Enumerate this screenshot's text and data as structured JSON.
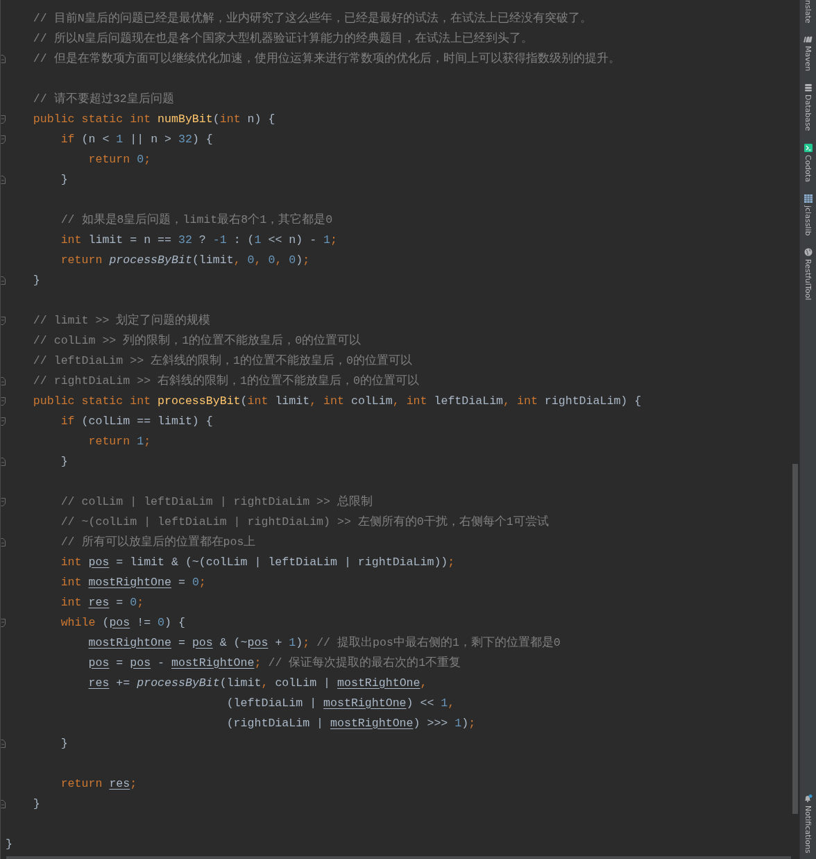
{
  "editor": {
    "lines": [
      {
        "kind": "code",
        "fold_start": false,
        "fold_end": false,
        "tokens": [
          {
            "kind": "comment",
            "text": "    // 目前N皇后的问题已经是最优解，业内研究了这么些年，已经是最好的试法，在试法上已经没有突破了。"
          }
        ]
      },
      {
        "kind": "code",
        "fold_start": false,
        "fold_end": false,
        "tokens": [
          {
            "kind": "comment",
            "text": "    // 所以N皇后问题现在也是各个国家大型机器验证计算能力的经典题目，在试法上已经到头了。"
          }
        ]
      },
      {
        "kind": "code",
        "fold_start": false,
        "fold_end": true,
        "tokens": [
          {
            "kind": "comment",
            "text": "    // 但是在常数项方面可以继续优化加速，使用位运算来进行常数项的优化后，时间上可以获得指数级别的提升。"
          }
        ]
      },
      {
        "kind": "blank"
      },
      {
        "kind": "code",
        "fold_start": false,
        "fold_end": false,
        "tokens": [
          {
            "kind": "comment",
            "text": "    // 请不要超过32皇后问题"
          }
        ]
      },
      {
        "kind": "code",
        "fold_start": true,
        "fold_end": false,
        "tokens": [
          {
            "kind": "keyword",
            "text": "    public static int "
          },
          {
            "kind": "method",
            "text": "numByBit"
          },
          {
            "kind": "text",
            "text": "("
          },
          {
            "kind": "keyword",
            "text": "int "
          },
          {
            "kind": "text",
            "text": "n) {"
          }
        ]
      },
      {
        "kind": "code",
        "fold_start": true,
        "fold_end": false,
        "tokens": [
          {
            "kind": "keyword",
            "text": "        if "
          },
          {
            "kind": "text",
            "text": "(n < "
          },
          {
            "kind": "number",
            "text": "1"
          },
          {
            "kind": "text",
            "text": " || n > "
          },
          {
            "kind": "number",
            "text": "32"
          },
          {
            "kind": "text",
            "text": ") {"
          }
        ]
      },
      {
        "kind": "code",
        "fold_start": false,
        "fold_end": false,
        "tokens": [
          {
            "kind": "keyword",
            "text": "            return "
          },
          {
            "kind": "number",
            "text": "0"
          },
          {
            "kind": "punct",
            "text": ";"
          }
        ]
      },
      {
        "kind": "code",
        "fold_start": false,
        "fold_end": true,
        "tokens": [
          {
            "kind": "text",
            "text": "        }"
          }
        ]
      },
      {
        "kind": "blank"
      },
      {
        "kind": "code",
        "fold_start": false,
        "fold_end": false,
        "tokens": [
          {
            "kind": "comment",
            "text": "        // 如果是8皇后问题，limit最右8个1，其它都是0"
          }
        ]
      },
      {
        "kind": "code",
        "fold_start": false,
        "fold_end": false,
        "tokens": [
          {
            "kind": "keyword",
            "text": "        int "
          },
          {
            "kind": "text",
            "text": "limit = n == "
          },
          {
            "kind": "number",
            "text": "32"
          },
          {
            "kind": "text",
            "text": " ? "
          },
          {
            "kind": "number",
            "text": "-1"
          },
          {
            "kind": "text",
            "text": " : ("
          },
          {
            "kind": "number",
            "text": "1"
          },
          {
            "kind": "text",
            "text": " << n) - "
          },
          {
            "kind": "number",
            "text": "1"
          },
          {
            "kind": "punct",
            "text": ";"
          }
        ]
      },
      {
        "kind": "code",
        "fold_start": false,
        "fold_end": false,
        "tokens": [
          {
            "kind": "keyword",
            "text": "        return "
          },
          {
            "kind": "call",
            "text": "processByBit"
          },
          {
            "kind": "text",
            "text": "(limit"
          },
          {
            "kind": "punct",
            "text": ","
          },
          {
            "kind": "number",
            "text": " 0"
          },
          {
            "kind": "punct",
            "text": ","
          },
          {
            "kind": "number",
            "text": " 0"
          },
          {
            "kind": "punct",
            "text": ","
          },
          {
            "kind": "number",
            "text": " 0"
          },
          {
            "kind": "text",
            "text": ")"
          },
          {
            "kind": "punct",
            "text": ";"
          }
        ]
      },
      {
        "kind": "code",
        "fold_start": false,
        "fold_end": true,
        "tokens": [
          {
            "kind": "text",
            "text": "    }"
          }
        ]
      },
      {
        "kind": "blank"
      },
      {
        "kind": "code",
        "fold_start": true,
        "fold_end": false,
        "tokens": [
          {
            "kind": "comment",
            "text": "    // limit >> 划定了问题的规模"
          }
        ]
      },
      {
        "kind": "code",
        "fold_start": false,
        "fold_end": false,
        "tokens": [
          {
            "kind": "comment",
            "text": "    // colLim >> 列的限制，1的位置不能放皇后，0的位置可以"
          }
        ]
      },
      {
        "kind": "code",
        "fold_start": false,
        "fold_end": false,
        "tokens": [
          {
            "kind": "comment",
            "text": "    // leftDiaLim >> 左斜线的限制，1的位置不能放皇后，0的位置可以"
          }
        ]
      },
      {
        "kind": "code",
        "fold_start": false,
        "fold_end": true,
        "tokens": [
          {
            "kind": "comment",
            "text": "    // rightDiaLim >> 右斜线的限制，1的位置不能放皇后，0的位置可以"
          }
        ]
      },
      {
        "kind": "code",
        "fold_start": true,
        "fold_end": false,
        "tokens": [
          {
            "kind": "keyword",
            "text": "    public static int "
          },
          {
            "kind": "method",
            "text": "processByBit"
          },
          {
            "kind": "text",
            "text": "("
          },
          {
            "kind": "keyword",
            "text": "int "
          },
          {
            "kind": "text",
            "text": "limit"
          },
          {
            "kind": "punct",
            "text": ","
          },
          {
            "kind": "keyword",
            "text": " int "
          },
          {
            "kind": "text",
            "text": "colLim"
          },
          {
            "kind": "punct",
            "text": ","
          },
          {
            "kind": "keyword",
            "text": " int "
          },
          {
            "kind": "text",
            "text": "leftDiaLim"
          },
          {
            "kind": "punct",
            "text": ","
          },
          {
            "kind": "keyword",
            "text": " int "
          },
          {
            "kind": "text",
            "text": "rightDiaLim) {"
          }
        ]
      },
      {
        "kind": "code",
        "fold_start": true,
        "fold_end": false,
        "tokens": [
          {
            "kind": "keyword",
            "text": "        if "
          },
          {
            "kind": "text",
            "text": "(colLim == limit) {"
          }
        ]
      },
      {
        "kind": "code",
        "fold_start": false,
        "fold_end": false,
        "tokens": [
          {
            "kind": "keyword",
            "text": "            return "
          },
          {
            "kind": "number",
            "text": "1"
          },
          {
            "kind": "punct",
            "text": ";"
          }
        ]
      },
      {
        "kind": "code",
        "fold_start": false,
        "fold_end": true,
        "tokens": [
          {
            "kind": "text",
            "text": "        }"
          }
        ]
      },
      {
        "kind": "blank"
      },
      {
        "kind": "code",
        "fold_start": true,
        "fold_end": false,
        "tokens": [
          {
            "kind": "comment",
            "text": "        // colLim | leftDiaLim | rightDiaLim >> 总限制"
          }
        ]
      },
      {
        "kind": "code",
        "fold_start": false,
        "fold_end": false,
        "tokens": [
          {
            "kind": "comment",
            "text": "        // ~(colLim | leftDiaLim | rightDiaLim) >> 左侧所有的0干扰，右侧每个1可尝试"
          }
        ]
      },
      {
        "kind": "code",
        "fold_start": false,
        "fold_end": true,
        "tokens": [
          {
            "kind": "comment",
            "text": "        // 所有可以放皇后的位置都在pos上"
          }
        ]
      },
      {
        "kind": "code",
        "fold_start": false,
        "fold_end": false,
        "tokens": [
          {
            "kind": "keyword",
            "text": "        int "
          },
          {
            "kind": "var",
            "text": "pos"
          },
          {
            "kind": "text",
            "text": " = limit & (~(colLim | leftDiaLim | rightDiaLim))"
          },
          {
            "kind": "punct",
            "text": ";"
          }
        ]
      },
      {
        "kind": "code",
        "fold_start": false,
        "fold_end": false,
        "tokens": [
          {
            "kind": "keyword",
            "text": "        int "
          },
          {
            "kind": "var",
            "text": "mostRightOne"
          },
          {
            "kind": "text",
            "text": " = "
          },
          {
            "kind": "number",
            "text": "0"
          },
          {
            "kind": "punct",
            "text": ";"
          }
        ]
      },
      {
        "kind": "code",
        "fold_start": false,
        "fold_end": false,
        "tokens": [
          {
            "kind": "keyword",
            "text": "        int "
          },
          {
            "kind": "var",
            "text": "res"
          },
          {
            "kind": "text",
            "text": " = "
          },
          {
            "kind": "number",
            "text": "0"
          },
          {
            "kind": "punct",
            "text": ";"
          }
        ]
      },
      {
        "kind": "code",
        "fold_start": true,
        "fold_end": false,
        "tokens": [
          {
            "kind": "keyword",
            "text": "        while "
          },
          {
            "kind": "text",
            "text": "("
          },
          {
            "kind": "var",
            "text": "pos"
          },
          {
            "kind": "text",
            "text": " != "
          },
          {
            "kind": "number",
            "text": "0"
          },
          {
            "kind": "text",
            "text": ") {"
          }
        ]
      },
      {
        "kind": "code",
        "fold_start": false,
        "fold_end": false,
        "tokens": [
          {
            "kind": "var",
            "text": "            mostRightOne"
          },
          {
            "kind": "text",
            "text": " = "
          },
          {
            "kind": "var",
            "text": "pos"
          },
          {
            "kind": "text",
            "text": " & (~"
          },
          {
            "kind": "var",
            "text": "pos"
          },
          {
            "kind": "text",
            "text": " + "
          },
          {
            "kind": "number",
            "text": "1"
          },
          {
            "kind": "text",
            "text": ")"
          },
          {
            "kind": "punct",
            "text": ";"
          },
          {
            "kind": "comment",
            "text": " // 提取出pos中最右侧的1，剩下的位置都是0"
          }
        ]
      },
      {
        "kind": "code",
        "fold_start": false,
        "fold_end": false,
        "tokens": [
          {
            "kind": "var",
            "text": "            pos"
          },
          {
            "kind": "text",
            "text": " = "
          },
          {
            "kind": "var",
            "text": "pos"
          },
          {
            "kind": "text",
            "text": " - "
          },
          {
            "kind": "var",
            "text": "mostRightOne"
          },
          {
            "kind": "punct",
            "text": ";"
          },
          {
            "kind": "comment",
            "text": " // 保证每次提取的最右次的1不重复"
          }
        ]
      },
      {
        "kind": "code",
        "fold_start": false,
        "fold_end": false,
        "tokens": [
          {
            "kind": "var",
            "text": "            res"
          },
          {
            "kind": "text",
            "text": " += "
          },
          {
            "kind": "call",
            "text": "processByBit"
          },
          {
            "kind": "text",
            "text": "(limit"
          },
          {
            "kind": "punct",
            "text": ","
          },
          {
            "kind": "text",
            "text": " colLim | "
          },
          {
            "kind": "var",
            "text": "mostRightOne"
          },
          {
            "kind": "punct",
            "text": ","
          }
        ]
      },
      {
        "kind": "code",
        "fold_start": false,
        "fold_end": false,
        "tokens": [
          {
            "kind": "text",
            "text": "                                (leftDiaLim | "
          },
          {
            "kind": "var",
            "text": "mostRightOne"
          },
          {
            "kind": "text",
            "text": ") << "
          },
          {
            "kind": "number",
            "text": "1"
          },
          {
            "kind": "punct",
            "text": ","
          }
        ]
      },
      {
        "kind": "code",
        "fold_start": false,
        "fold_end": false,
        "tokens": [
          {
            "kind": "text",
            "text": "                                (rightDiaLim | "
          },
          {
            "kind": "var",
            "text": "mostRightOne"
          },
          {
            "kind": "text",
            "text": ") >>> "
          },
          {
            "kind": "number",
            "text": "1"
          },
          {
            "kind": "text",
            "text": ")"
          },
          {
            "kind": "punct",
            "text": ";"
          }
        ]
      },
      {
        "kind": "code",
        "fold_start": false,
        "fold_end": true,
        "tokens": [
          {
            "kind": "text",
            "text": "        }"
          }
        ]
      },
      {
        "kind": "blank"
      },
      {
        "kind": "code",
        "fold_start": false,
        "fold_end": false,
        "tokens": [
          {
            "kind": "keyword",
            "text": "        return "
          },
          {
            "kind": "var",
            "text": "res"
          },
          {
            "kind": "punct",
            "text": ";"
          }
        ]
      },
      {
        "kind": "code",
        "fold_start": false,
        "fold_end": true,
        "tokens": [
          {
            "kind": "text",
            "text": "    }"
          }
        ]
      },
      {
        "kind": "blank"
      },
      {
        "kind": "code",
        "fold_start": false,
        "fold_end": false,
        "tokens": [
          {
            "kind": "text",
            "text": "}"
          }
        ]
      }
    ]
  },
  "tool_sidebar": {
    "items": [
      {
        "label": "nslate"
      },
      {
        "label": "Maven"
      },
      {
        "label": "Database"
      },
      {
        "label": "Codota"
      },
      {
        "label": "jclasslib"
      },
      {
        "label": "RestfulTool"
      }
    ],
    "bottom_items": [
      {
        "label": "Notifications"
      }
    ]
  }
}
